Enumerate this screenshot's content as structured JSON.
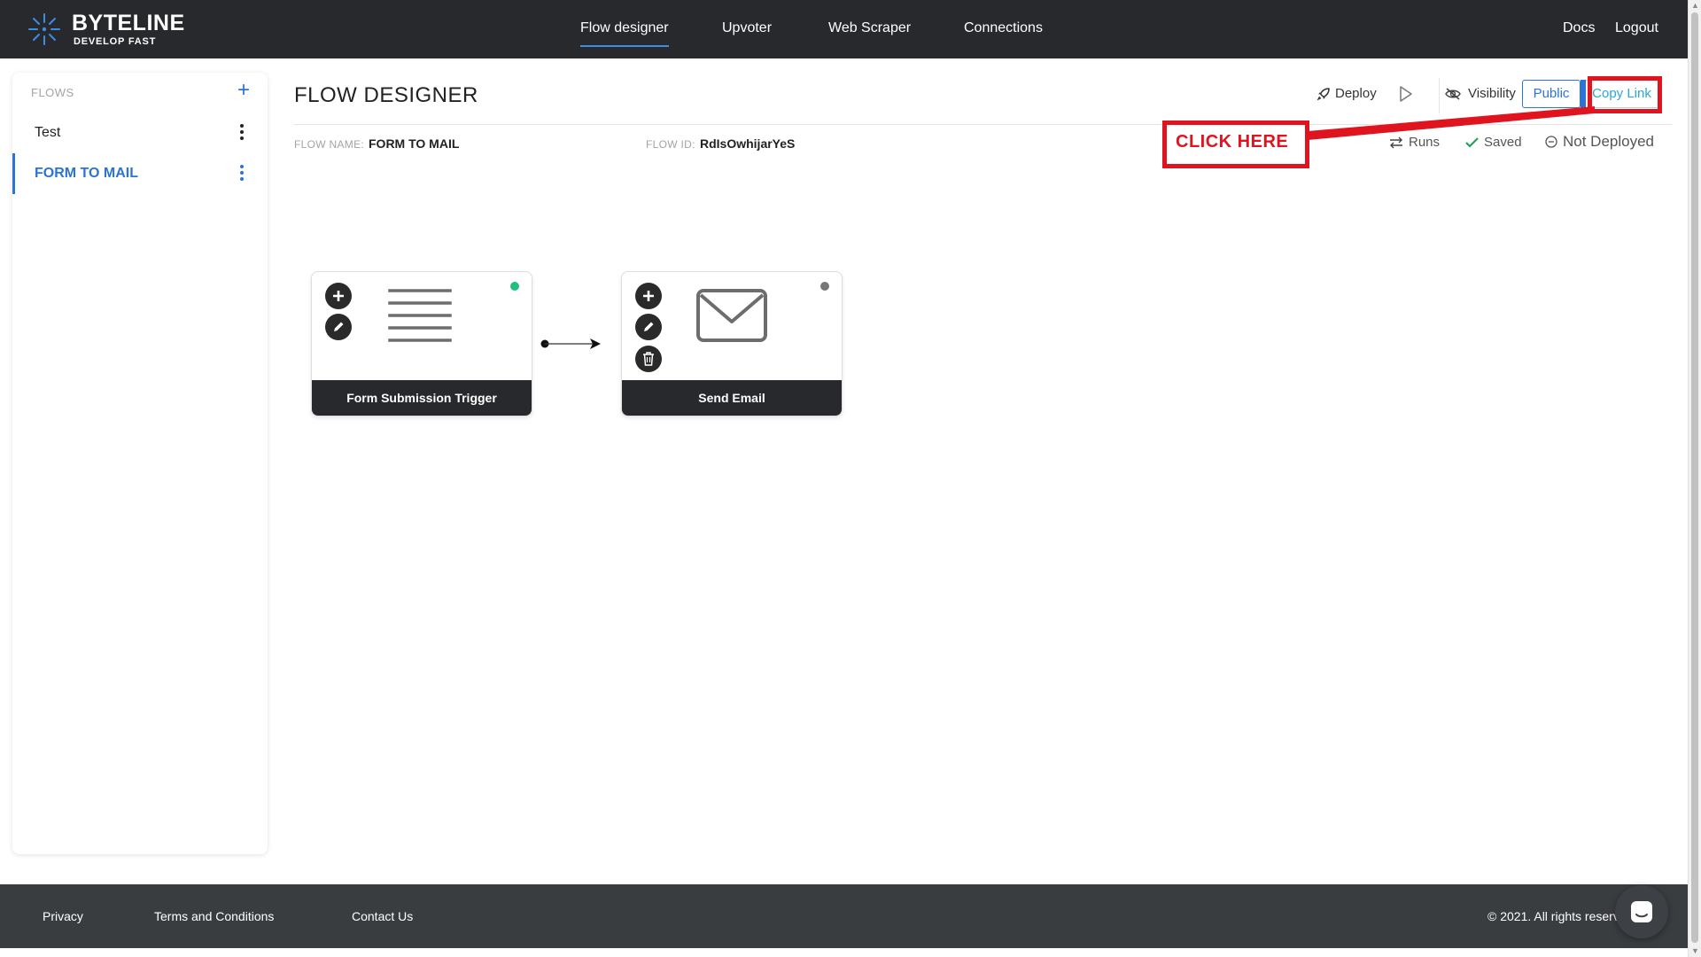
{
  "brand": {
    "title": "BYTELINE",
    "subtitle": "DEVELOP FAST"
  },
  "nav": {
    "items": [
      {
        "label": "Flow designer",
        "active": true
      },
      {
        "label": "Upvoter"
      },
      {
        "label": "Web Scraper"
      },
      {
        "label": "Connections"
      }
    ],
    "right": [
      {
        "label": "Docs"
      },
      {
        "label": "Logout"
      }
    ]
  },
  "sidebar": {
    "heading": "FLOWS",
    "add_icon": "+",
    "items": [
      {
        "label": "Test",
        "active": false
      },
      {
        "label": "FORM TO MAIL",
        "active": true
      }
    ]
  },
  "header": {
    "title": "FLOW DESIGNER",
    "deploy_label": "Deploy",
    "visibility_label": "Visibility",
    "public_label": "Public",
    "copy_link_label": "Copy Link",
    "flow_name_label": "FLOW NAME:",
    "flow_name": "FORM TO MAIL",
    "flow_id_label": "FLOW ID:",
    "flow_id": "RdIsOwhijarYeS",
    "runs_label": "Runs",
    "saved_label": "Saved",
    "deploy_status": "Not Deployed"
  },
  "annotation": {
    "text": "CLICK HERE",
    "color": "#e0141e"
  },
  "flow": {
    "nodes": [
      {
        "title": "Form Submission Trigger",
        "icon": "form-lines-icon",
        "status_color": "#1fc27a"
      },
      {
        "title": "Send Email",
        "icon": "envelope-icon",
        "status_color": "#777777"
      }
    ]
  },
  "footer": {
    "links": [
      {
        "label": "Privacy"
      },
      {
        "label": "Terms and Conditions"
      },
      {
        "label": "Contact Us"
      }
    ],
    "copyright": "© 2021. All rights reserved."
  },
  "colors": {
    "accent": "#2b74d6",
    "nav_bg": "#27292c",
    "footer_bg": "#3a3d40"
  }
}
